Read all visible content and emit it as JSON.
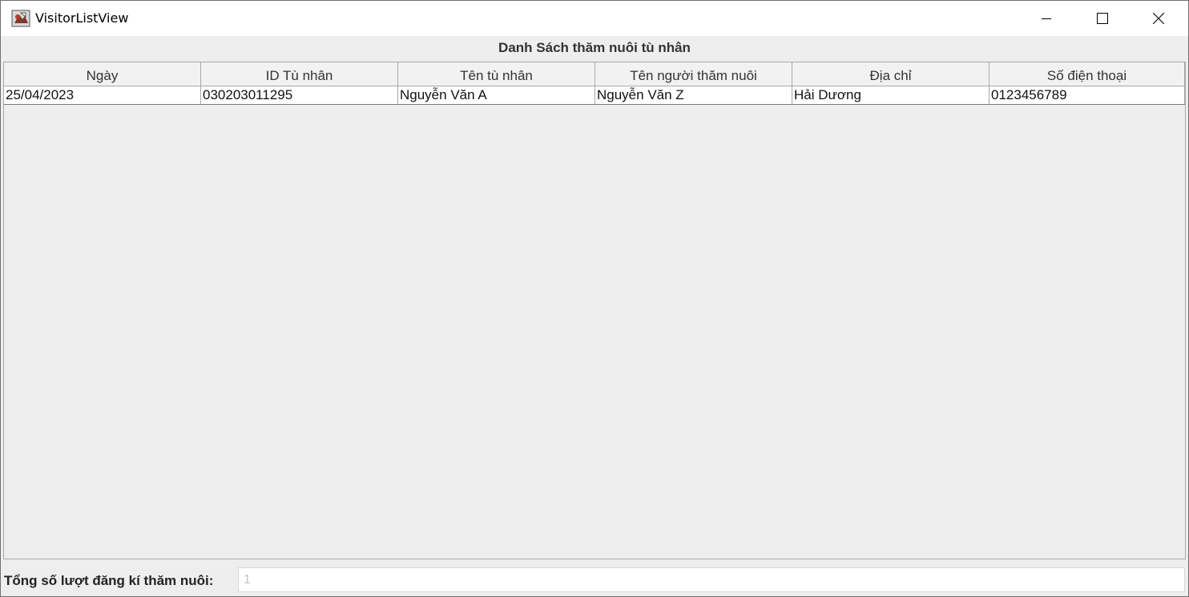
{
  "window": {
    "title": "VisitorListView",
    "app_icon": "java-coffee-icon",
    "controls": {
      "minimize_icon": "minimize-icon",
      "maximize_icon": "maximize-icon",
      "close_icon": "close-icon"
    }
  },
  "heading": "Danh Sách thăm nuôi tù nhân",
  "table": {
    "columns": [
      "Ngày",
      "ID Tù nhân",
      "Tên tù nhân",
      "Tên người thăm nuôi",
      "Địa chỉ",
      "Số điện thoại"
    ],
    "rows": [
      [
        "25/04/2023",
        "030203011295",
        "Nguyễn Văn A",
        "Nguyễn Văn Z",
        "Hải Dương",
        "0123456789"
      ]
    ]
  },
  "footer": {
    "total_label": "Tổng số lượt đăng kí thăm nuôi:",
    "total_value": "1"
  },
  "colors": {
    "window_bg": "#eeeeee",
    "titlebar_bg": "#ffffff",
    "disabled_text": "#b8c4d8"
  }
}
